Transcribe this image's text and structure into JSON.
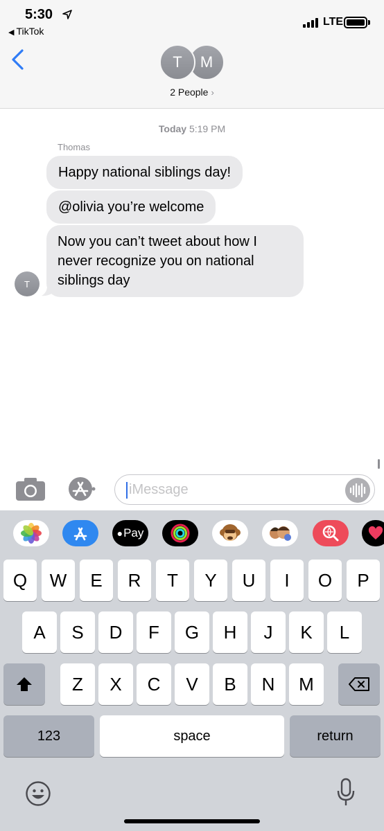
{
  "status_bar": {
    "time": "5:30",
    "back_app": "TikTok",
    "network": "LTE"
  },
  "header": {
    "avatars": [
      "T",
      "M"
    ],
    "participants_label": "2 People",
    "chevron": "›"
  },
  "conversation": {
    "timestamp_day": "Today",
    "timestamp_time": "5:19 PM",
    "sender_name": "Thomas",
    "sender_initial": "T",
    "messages": [
      "Happy national siblings day!",
      "@olivia you’re welcome",
      "Now you can’t tweet about how I never recognize you on national siblings day"
    ]
  },
  "compose": {
    "placeholder": "iMessage"
  },
  "app_drawer": {
    "icons": [
      "photos-icon",
      "app-store-icon",
      "apple-pay-icon",
      "activity-icon",
      "animoji-icon",
      "memoji-icon",
      "web-search-icon",
      "digital-touch-icon"
    ],
    "apple_pay_label": "Pay"
  },
  "keyboard": {
    "row1": [
      "Q",
      "W",
      "E",
      "R",
      "T",
      "Y",
      "U",
      "I",
      "O",
      "P"
    ],
    "row2": [
      "A",
      "S",
      "D",
      "F",
      "G",
      "H",
      "J",
      "K",
      "L"
    ],
    "row3": [
      "Z",
      "X",
      "C",
      "V",
      "B",
      "N",
      "M"
    ],
    "numbers_label": "123",
    "space_label": "space",
    "return_label": "return"
  },
  "colors": {
    "accent": "#2f7cf6",
    "bubble_gray": "#e9e9eb",
    "keyboard_bg": "#d1d4d9"
  }
}
